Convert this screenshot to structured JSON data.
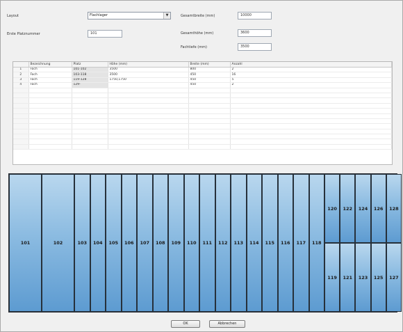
{
  "form": {
    "layout_label": "Layout",
    "layout_value": "Flachlager",
    "first_place_label": "Erste Platznummer",
    "first_place_value": "101",
    "total_width_label": "Gesamtbreite (mm)",
    "total_width_value": "10000",
    "total_height_label": "Gesamthöhe (mm)",
    "total_height_value": "3600",
    "depth_label": "Fachtiefe (mm)",
    "depth_value": "3500"
  },
  "grid": {
    "headers": [
      "",
      "Bezeichnung",
      "Platz",
      "Höhe (mm)",
      "Breite (mm)",
      "Anzahl"
    ],
    "rows": [
      [
        "1",
        "Fach",
        "101-102",
        "3500",
        "800",
        "2"
      ],
      [
        "2",
        "Fach",
        "103-118",
        "3500",
        "450",
        "16"
      ],
      [
        "3",
        "Fach",
        "119-128",
        "1750,1750",
        "450",
        "5"
      ],
      [
        "4",
        "Fach",
        "129-",
        "",
        "450",
        "2"
      ]
    ],
    "empty_rows": 12
  },
  "shelves": {
    "big": [
      "101",
      "102"
    ],
    "narrow": [
      "103",
      "104",
      "105",
      "106",
      "107",
      "108",
      "109",
      "110",
      "111",
      "112",
      "113",
      "114",
      "115",
      "116",
      "117",
      "118"
    ],
    "stack_top": [
      "120",
      "122",
      "124",
      "126",
      "128"
    ],
    "stack_bottom": [
      "119",
      "121",
      "123",
      "125",
      "127"
    ]
  },
  "buttons": {
    "ok": "OK",
    "cancel": "Abbrechen"
  },
  "colors": {
    "background": "#f0f0f0",
    "shelf_top": "#b9d7ee",
    "shelf_bottom": "#5d9bd1",
    "shelf_frame": "#2a2f36"
  }
}
